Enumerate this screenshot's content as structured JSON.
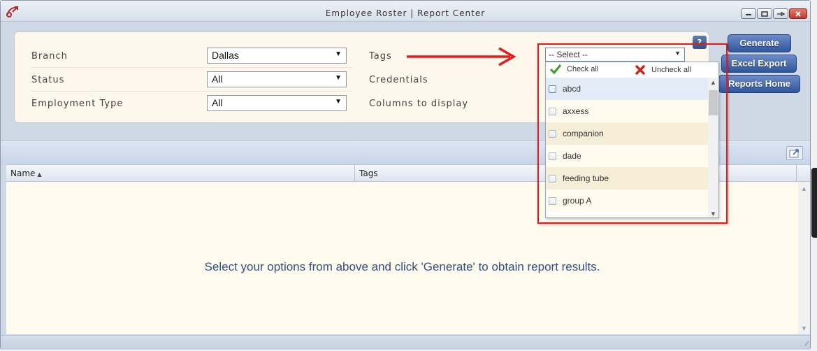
{
  "window": {
    "title": "Employee Roster | Report Center"
  },
  "filters": {
    "branch": {
      "label": "Branch",
      "value": "Dallas"
    },
    "status": {
      "label": "Status",
      "value": "All"
    },
    "employment_type": {
      "label": "Employment Type",
      "value": "All"
    },
    "tags_label": "Tags",
    "credentials_label": "Credentials",
    "columns_label": "Columns to display"
  },
  "help_label": "?",
  "actions": {
    "generate": "Generate",
    "excel_export": "Excel Export",
    "reports_home": "Reports Home"
  },
  "tags_dropdown": {
    "placeholder": "-- Select --",
    "check_all": "Check all",
    "uncheck_all": "Uncheck all",
    "items": [
      "abcd",
      "axxess",
      "companion",
      "dade",
      "feeding tube",
      "group A"
    ]
  },
  "grid": {
    "columns": [
      "Name",
      "Tags"
    ],
    "sort_indicator": "▲",
    "empty_message": "Select your options from above and click 'Generate' to obtain report results."
  },
  "colors": {
    "accent_button": "#2f569b",
    "highlight_red": "#e31b1b",
    "message_blue": "#2f4f86",
    "panel_bg": "#fdf7ec"
  }
}
